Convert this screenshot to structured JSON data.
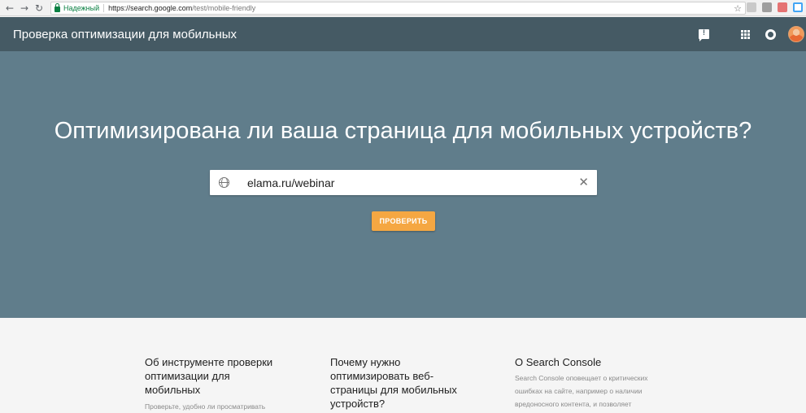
{
  "browser": {
    "back_icon": "arrow-left-icon",
    "forward_icon": "arrow-right-icon",
    "reload_icon": "reload-icon",
    "secure_label": "Надежный",
    "url_host": "https://search.google.com",
    "url_path": "/test/mobile-friendly"
  },
  "appbar": {
    "title": "Проверка оптимизации для мобильных"
  },
  "hero": {
    "heading": "Оптимизирована ли ваша страница для мобильных устройств?",
    "url_value": "elama.ru/webinar",
    "button_label": "ПРОВЕРИТЬ"
  },
  "info": {
    "columns": [
      {
        "title": "Об инструменте проверки оптимизации для мобильных",
        "text": "Проверьте, удобно ли просматривать"
      },
      {
        "title": "Почему нужно оптимизировать веб-страницы для мобильных устройств?",
        "text": ""
      },
      {
        "title": "О Search Console",
        "text": "Search Console оповещает о критических ошибках на сайте, например о наличии вредоносного контента, и позволяет"
      }
    ]
  },
  "colors": {
    "appbar_bg": "#455a64",
    "hero_bg": "#607d8b",
    "button_bg": "#f5a742",
    "secure_green": "#0b8043"
  }
}
